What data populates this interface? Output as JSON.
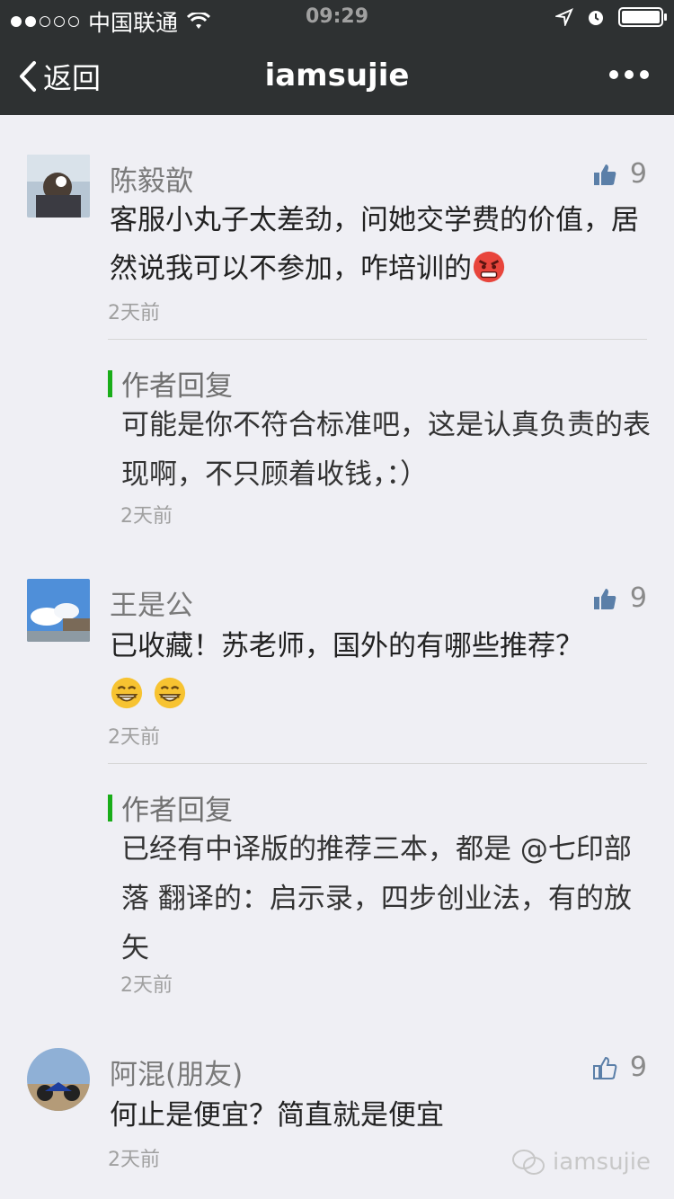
{
  "status_bar": {
    "carrier": "中国联通",
    "time": "09:29",
    "signal_bars_filled": 2,
    "signal_bars_total": 5,
    "battery_level": 1.0
  },
  "nav": {
    "back_label": "返回",
    "title": "iamsujie"
  },
  "comments": [
    {
      "name": "陈毅歆",
      "likes": "9",
      "text": "客服小丸子太差劲，问她交学费的价值，居然说我可以不参加，咋培训的",
      "emoji": "angry-face",
      "time": "2天前",
      "reply": {
        "label": "作者回复",
        "text": "可能是你不符合标准吧，这是认真负责的表现啊，不只顾着收钱，：）",
        "time": "2天前"
      }
    },
    {
      "name": "王是公",
      "likes": "9",
      "text": "已收藏！苏老师，国外的有哪些推荐？",
      "emoji": "grin-face",
      "time": "2天前",
      "reply": {
        "label": "作者回复",
        "text": "已经有中译版的推荐三本，都是 @七印部落 翻译的：启示录，四步创业法，有的放矢",
        "time": "2天前"
      }
    },
    {
      "name": "阿混(朋友)",
      "likes": "9",
      "text": "何止是便宜？简直就是便宜",
      "time": "2天前"
    }
  ],
  "watermark": "iamsujie",
  "colors": {
    "nav_bg": "#2e3132",
    "page_bg": "#efeff4",
    "reply_bar": "#1aad19",
    "like_icon": "#5b7fa8"
  }
}
